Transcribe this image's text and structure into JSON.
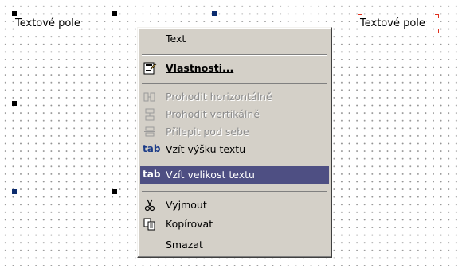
{
  "canvas": {
    "left_field_label": "Textové pole",
    "right_field_label": "Textové pole"
  },
  "context_menu": {
    "items": [
      {
        "label": "Text",
        "state": "normal"
      },
      {
        "label": "Vlastnosti...",
        "state": "normal",
        "icon": "properties-icon"
      },
      {
        "label": "Prohodit horizontálně",
        "state": "disabled",
        "icon": "swap-horizontal-icon"
      },
      {
        "label": "Prohodit vertikálně",
        "state": "disabled",
        "icon": "swap-vertical-icon"
      },
      {
        "label": "Přilepit pod sebe",
        "state": "disabled",
        "icon": "stack-icon"
      },
      {
        "label": "Vzít výšku textu",
        "state": "normal",
        "icon": "tab-text-height-icon"
      },
      {
        "label": "Vzít velikost textu",
        "state": "highlighted",
        "icon": "tab-text-size-icon"
      },
      {
        "label": "Vyjmout",
        "state": "normal",
        "icon": "scissors-icon"
      },
      {
        "label": "Kopírovat",
        "state": "normal",
        "icon": "copy-icon"
      },
      {
        "label": "Smazat",
        "state": "normal"
      }
    ],
    "icon_text": "tab"
  },
  "colors": {
    "menu_bg": "#d4d0c8",
    "highlight_bg": "#4e4f83",
    "disabled_text": "#8d8d8d",
    "selection_handle": "#000000",
    "selection_corner": "#e0301e"
  }
}
